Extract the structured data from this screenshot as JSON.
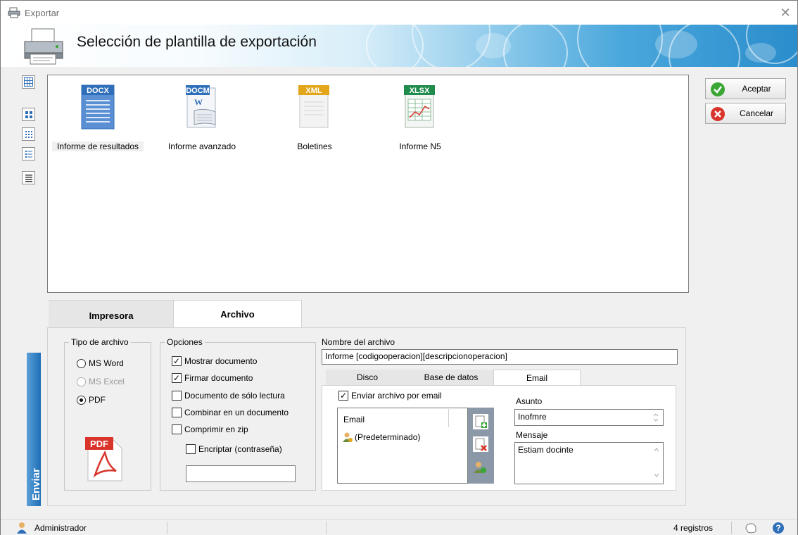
{
  "window": {
    "title": "Exportar",
    "close_glyph": "✕"
  },
  "banner": {
    "heading": "Selección de plantilla de exportación"
  },
  "templates": [
    {
      "label": "Informe de resultados",
      "badge": "DOCX",
      "badge_color": "#2f6fba"
    },
    {
      "label": "Informe avanzado",
      "badge": "DOCM",
      "badge_color": "#2f6fba"
    },
    {
      "label": "Boletines",
      "badge": "XML",
      "badge_color": "#e3a51a"
    },
    {
      "label": "Informe N5",
      "badge": "XLSX",
      "badge_color": "#1f8b4c"
    }
  ],
  "actions": {
    "accept": "Aceptar",
    "cancel": "Cancelar"
  },
  "tabs": {
    "printer": "Impresora",
    "file": "Archivo"
  },
  "side_button": "Enviar",
  "file_type": {
    "legend": "Tipo de archivo",
    "options": [
      "MS Word",
      "MS Excel",
      "PDF"
    ],
    "selected": "PDF",
    "pdf_icon_text": "PDF"
  },
  "options": {
    "legend": "Opciones",
    "show_document": "Mostrar documento",
    "sign_document": "Firmar documento",
    "read_only": "Documento de sólo lectura",
    "combine": "Combinar en un documento",
    "zip": "Comprimir en zip",
    "encrypt": "Encriptar (contraseña)",
    "password": ""
  },
  "filename": {
    "label": "Nombre del archivo",
    "value": "Informe [codigooperacion][descripcionoperacion]"
  },
  "subtabs": {
    "disk": "Disco",
    "db": "Base de datos",
    "email": "Email"
  },
  "email": {
    "send": "Enviar archivo por email",
    "list_header": "Email",
    "recipients": [
      "(Predeterminado)"
    ],
    "subject_label": "Asunto",
    "subject_value": "Inofmre",
    "message_label": "Mensaje",
    "message_value": "Estiam docinte"
  },
  "status": {
    "user": "Administrador",
    "records": "4 registros"
  },
  "colors": {
    "accent_blue": "#2b8dcc",
    "ok_green": "#3aa635",
    "cancel_red": "#d9342b"
  }
}
